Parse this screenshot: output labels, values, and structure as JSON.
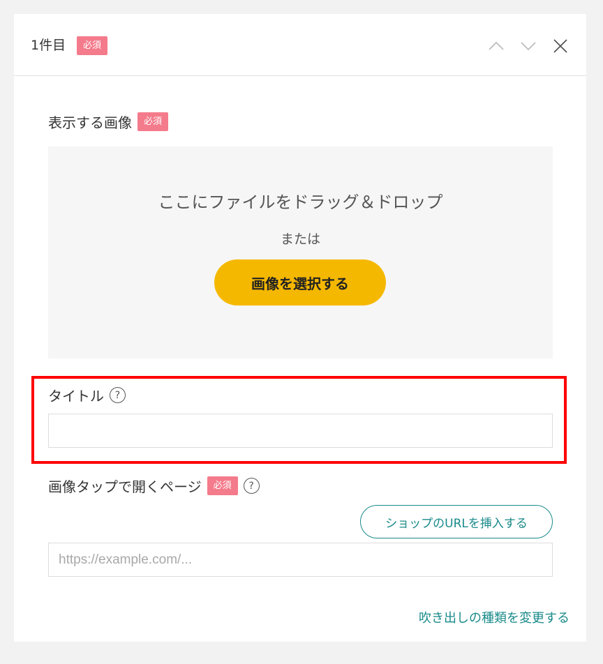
{
  "header": {
    "title": "1件目",
    "badge": "必須"
  },
  "image_section": {
    "label": "表示する画像",
    "badge": "必須",
    "dropzone_text": "ここにファイルをドラッグ＆ドロップ",
    "or_text": "または",
    "select_button": "画像を選択する"
  },
  "title_section": {
    "label": "タイトル",
    "help": "?",
    "value": ""
  },
  "page_section": {
    "label": "画像タップで開くページ",
    "badge": "必須",
    "help": "?",
    "shop_button": "ショップのURLを挿入する",
    "url_placeholder": "https://example.com/...",
    "url_value": ""
  },
  "footer": {
    "change_link": "吹き出しの種類を変更する"
  },
  "colors": {
    "badge": "#f47b8b",
    "primary_button": "#f5b800",
    "link": "#1a8a8a",
    "highlight": "#ff0000"
  },
  "icons": [
    "chevron-up-icon",
    "chevron-down-icon",
    "close-icon",
    "help-icon"
  ]
}
